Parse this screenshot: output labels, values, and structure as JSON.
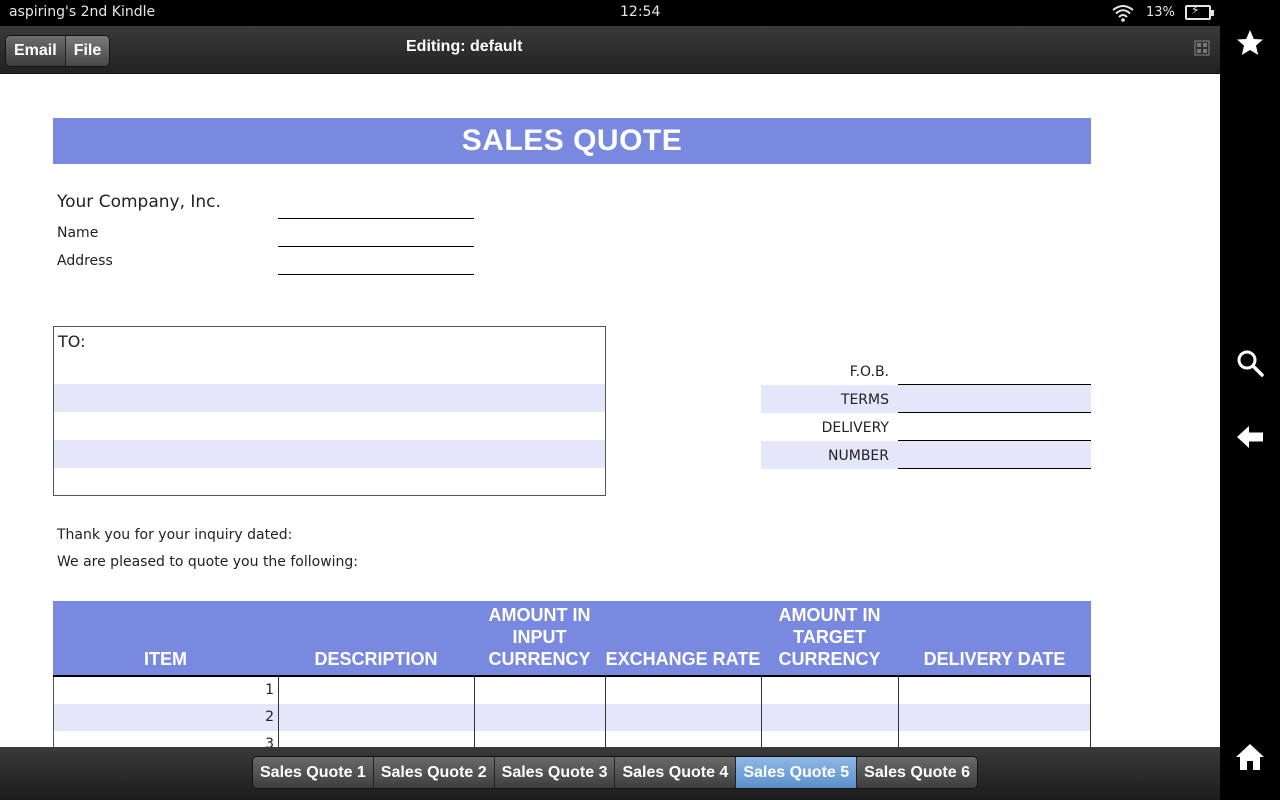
{
  "status": {
    "device_name": "aspiring's 2nd Kindle",
    "time": "12:54",
    "battery_percent": "13%"
  },
  "toolbar": {
    "email_label": "Email",
    "file_label": "File",
    "title": "Editing: default"
  },
  "doc": {
    "banner": "SALES QUOTE",
    "company": "Your Company, Inc.",
    "name_label": "Name",
    "address_label": "Address",
    "to_label": "TO:",
    "fob": [
      "F.O.B.",
      "TERMS",
      "DELIVERY",
      "NUMBER"
    ],
    "thanks": "Thank you for your inquiry dated:",
    "pleased": "We are pleased to quote you the following:",
    "headers": {
      "item": "ITEM",
      "description": "DESCRIPTION",
      "amount_input": [
        "AMOUNT IN",
        "INPUT",
        "CURRENCY"
      ],
      "exchange": "EXCHANGE RATE",
      "amount_target": [
        "AMOUNT IN",
        "TARGET",
        "CURRENCY"
      ],
      "delivery": "DELIVERY DATE"
    },
    "rows": [
      "1",
      "2",
      "3"
    ]
  },
  "tabs": [
    "Sales Quote 1",
    "Sales Quote 2",
    "Sales Quote 3",
    "Sales Quote 4",
    "Sales Quote 5",
    "Sales Quote 6"
  ],
  "active_tab": "Sales Quote 5",
  "colors": {
    "header_blue": "#7a89e0",
    "stripe": "#e4e6fa",
    "active_tab": "#6f9fd6"
  }
}
